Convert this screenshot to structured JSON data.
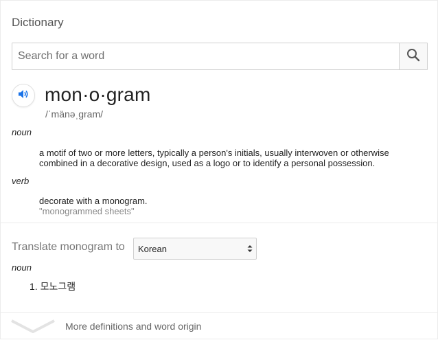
{
  "card": {
    "title": "Dictionary",
    "search": {
      "placeholder": "Search for a word",
      "value": ""
    },
    "entry": {
      "word": "mon·o·gram",
      "phonetic": "/ˈmänəˌɡram/",
      "senses": [
        {
          "pos": "noun",
          "definition": "a motif of two or more letters, typically a person's initials, usually interwoven or otherwise combined in a decorative design, used as a logo or to identify a personal possession.",
          "example": ""
        },
        {
          "pos": "verb",
          "definition": "decorate with a monogram.",
          "example": "\"monogrammed sheets\""
        }
      ]
    },
    "translate": {
      "label": "Translate monogram to",
      "selected_language": "Korean",
      "pos": "noun",
      "results": [
        "1. 모노그램"
      ]
    },
    "more_link": "More definitions and word origin"
  },
  "colors": {
    "accent": "#1a73e8",
    "muted": "#777777",
    "example": "#888888"
  }
}
